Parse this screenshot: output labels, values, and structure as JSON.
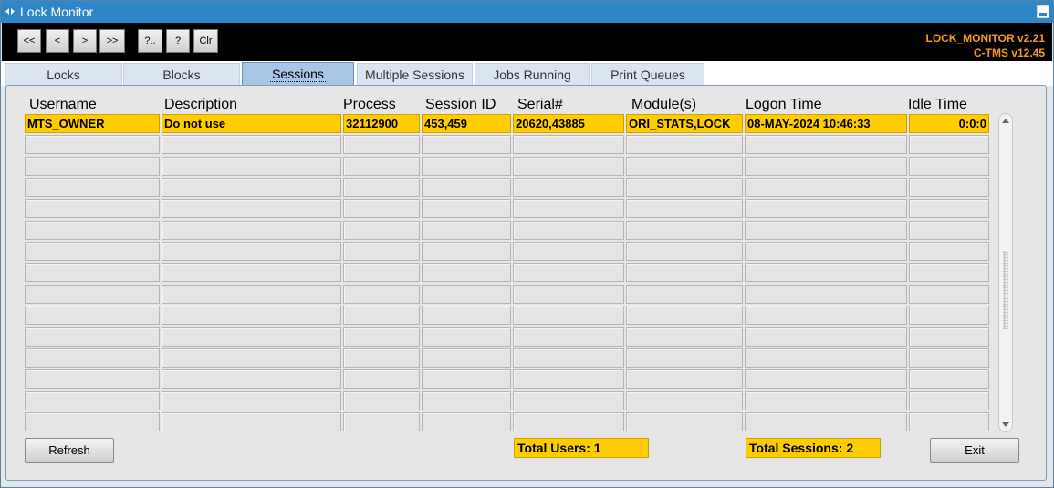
{
  "window": {
    "title": "Lock Monitor"
  },
  "toolbar": {
    "buttons": [
      "<<",
      "<",
      ">",
      ">>",
      "?..",
      "?",
      "Clr"
    ],
    "version_line1": "LOCK_MONITOR v2.21",
    "version_line2": "C-TMS v12.45"
  },
  "tabs": [
    "Locks",
    "Blocks",
    "Sessions",
    "Multiple Sessions",
    "Jobs Running",
    "Print Queues"
  ],
  "active_tab": "Sessions",
  "table": {
    "columns": [
      "Username",
      "Description",
      "Process",
      "Session ID",
      "Serial#",
      "Module(s)",
      "Logon Time",
      "Idle Time"
    ],
    "rows": [
      [
        "MTS_OWNER",
        "Do not use",
        "32112900",
        "453,459",
        "20620,43885",
        "ORI_STATS,LOCK",
        "08-MAY-2024 10:46:33",
        "0:0:0"
      ]
    ],
    "total_rows": 15
  },
  "footer": {
    "refresh_label": "Refresh",
    "exit_label": "Exit",
    "total_users": "Total Users: 1",
    "total_sessions": "Total Sessions: 2"
  },
  "colors": {
    "titlebar": "#2f86c6",
    "highlight": "#ffcc00",
    "version_text": "#f39a2a"
  }
}
